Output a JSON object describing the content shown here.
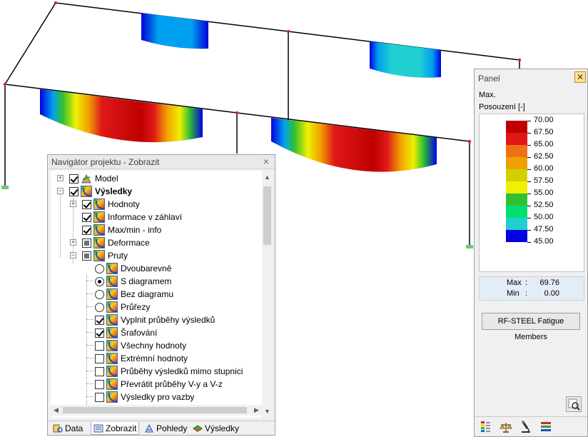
{
  "navigator": {
    "title": "Navigátor projektu - Zobrazit",
    "close": "×",
    "items": [
      {
        "label": "Model",
        "bold": false
      },
      {
        "label": "Výsledky",
        "bold": true
      },
      {
        "label": "Hodnoty",
        "bold": false
      },
      {
        "label": "Informace v záhlaví",
        "bold": false
      },
      {
        "label": "Max/min - info",
        "bold": false
      },
      {
        "label": "Deformace",
        "bold": false
      },
      {
        "label": "Pruty",
        "bold": false
      },
      {
        "label": "Dvoubarevně",
        "bold": false
      },
      {
        "label": "S diagramem",
        "bold": false
      },
      {
        "label": "Bez diagramu",
        "bold": false
      },
      {
        "label": "Průřezy",
        "bold": false
      },
      {
        "label": "Vyplnit průběhy výsledků",
        "bold": false
      },
      {
        "label": "Šrafování",
        "bold": false
      },
      {
        "label": "Všechny hodnoty",
        "bold": false
      },
      {
        "label": "Extrémní hodnoty",
        "bold": false
      },
      {
        "label": "Průběhy výsledků mimo stupnici",
        "bold": false
      },
      {
        "label": "Převrátit průběhy V-y a V-z",
        "bold": false
      },
      {
        "label": "Výsledky pro vazby",
        "bold": false
      }
    ],
    "tabs": [
      {
        "label": "Data",
        "icon": "data-icon"
      },
      {
        "label": "Zobrazit",
        "icon": "display-icon"
      },
      {
        "label": "Pohledy",
        "icon": "views-icon"
      },
      {
        "label": "Výsledky",
        "icon": "results-icon"
      }
    ]
  },
  "panel": {
    "title": "Panel",
    "close": "✕",
    "max_label": "Max.",
    "subtitle": "Posouzení [-]",
    "legend": [
      {
        "value": "70.00",
        "color": "#c00000"
      },
      {
        "value": "67.50",
        "color": "#e01818"
      },
      {
        "value": "65.00",
        "color": "#f07018"
      },
      {
        "value": "62.50",
        "color": "#f0a000"
      },
      {
        "value": "60.00",
        "color": "#d0d000"
      },
      {
        "value": "57.50",
        "color": "#f0f000"
      },
      {
        "value": "55.00",
        "color": "#30c030"
      },
      {
        "value": "52.50",
        "color": "#00e070"
      },
      {
        "value": "50.00",
        "color": "#20d0d0"
      },
      {
        "value": "47.50",
        "color": "#00a0f0"
      },
      {
        "value": "45.00",
        "color": "#0000e0"
      }
    ],
    "max_text": "Max",
    "max_value": "69.76",
    "min_text": "Min",
    "min_value": "0.00",
    "colon": ":",
    "fatigue_button": "RF-STEEL Fatigue Members"
  }
}
